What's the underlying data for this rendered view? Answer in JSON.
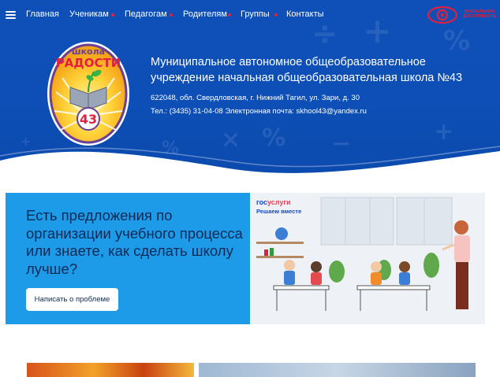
{
  "nav": {
    "items": [
      {
        "label": "Главная"
      },
      {
        "label": "Ученикам"
      },
      {
        "label": "Педагогам"
      },
      {
        "label": "Родителям"
      },
      {
        "label": "Группы"
      },
      {
        "label": "Контакты"
      }
    ]
  },
  "brand": {
    "text": "ВИЗУАЛЬНАЯ ДОСТУПНОСТЬ"
  },
  "emblem": {
    "top_text": "школа",
    "main_text": "РАДОСТИ",
    "number": "43"
  },
  "org": {
    "title": "Муниципальное автономное общеобразовательное учреждение начальная общеобразовательная школа №43",
    "address": "622048, обл. Свердловская, г. Нижний Тагил, ул. Зари, д. 30",
    "contacts": "Тел.: (3435) 31-04-08  Электронная почта: skhool43@yandex.ru"
  },
  "banner": {
    "heading": "Есть предложения по организации учебного процесса или знаете, как сделать школу лучше?",
    "button_label": "Написать о проблеме",
    "logo_part1": "гос",
    "logo_part2": "услуги",
    "logo_subtitle": "Решаем вместе"
  },
  "colors": {
    "header_blue": "#0f50b8",
    "accent_red": "#e0213d",
    "banner_blue": "#1d9be8",
    "banner_text": "#0d2a55"
  }
}
